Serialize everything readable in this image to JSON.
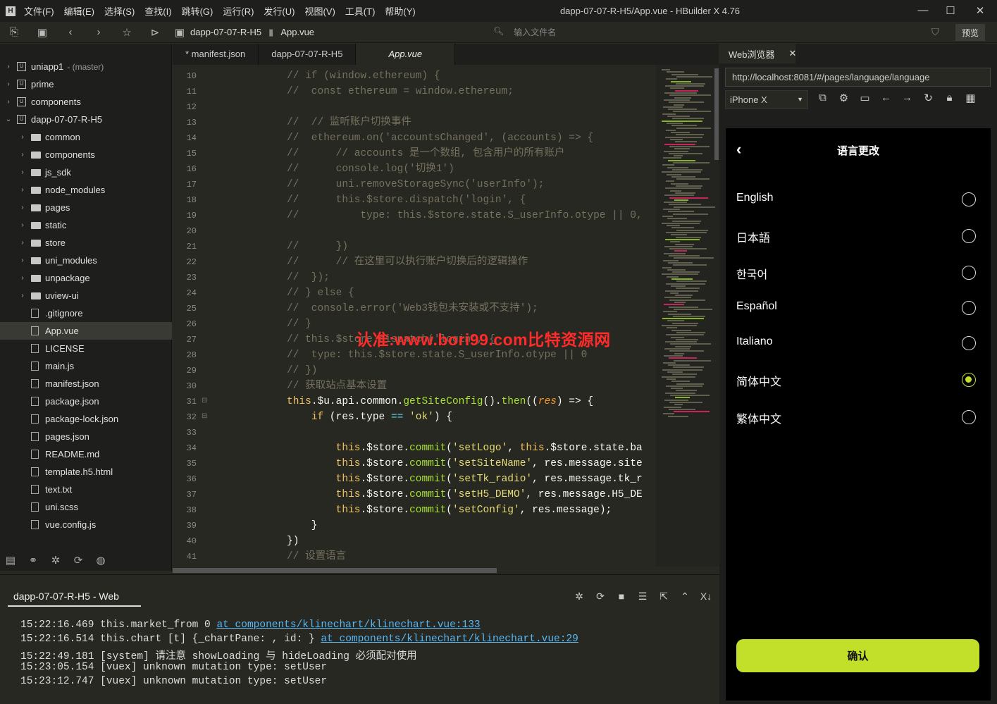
{
  "window": {
    "title": "dapp-07-07-R-H5/App.vue - HBuilder X 4.76",
    "minimize": "—",
    "maximize": "☐",
    "close": "✕"
  },
  "menu": [
    "文件(F)",
    "编辑(E)",
    "选择(S)",
    "查找(I)",
    "跳转(G)",
    "运行(R)",
    "发行(U)",
    "视图(V)",
    "工具(T)",
    "帮助(Y)"
  ],
  "toolbar": {
    "breadcrumb_project": "dapp-07-07-R-H5",
    "breadcrumb_file": "App.vue",
    "file_search_placeholder": "输入文件名",
    "preview_label": "预览"
  },
  "sidebar": {
    "rows": [
      {
        "label": "uniapp1",
        "branch": "- (master)",
        "kind": "project",
        "depth": 0,
        "chevron": "›"
      },
      {
        "label": "prime",
        "kind": "project",
        "depth": 0,
        "chevron": "›"
      },
      {
        "label": "components",
        "kind": "project",
        "depth": 0,
        "chevron": "›"
      },
      {
        "label": "dapp-07-07-R-H5",
        "kind": "project",
        "depth": 0,
        "chevron": "⌄"
      },
      {
        "label": "common",
        "kind": "folder",
        "depth": 1,
        "chevron": "›"
      },
      {
        "label": "components",
        "kind": "folder",
        "depth": 1,
        "chevron": "›"
      },
      {
        "label": "js_sdk",
        "kind": "folder",
        "depth": 1,
        "chevron": "›"
      },
      {
        "label": "node_modules",
        "kind": "folder",
        "depth": 1,
        "chevron": "›"
      },
      {
        "label": "pages",
        "kind": "folder",
        "depth": 1,
        "chevron": "›"
      },
      {
        "label": "static",
        "kind": "folder",
        "depth": 1,
        "chevron": "›"
      },
      {
        "label": "store",
        "kind": "folder",
        "depth": 1,
        "chevron": "›"
      },
      {
        "label": "uni_modules",
        "kind": "folder",
        "depth": 1,
        "chevron": "›"
      },
      {
        "label": "unpackage",
        "kind": "folder",
        "depth": 1,
        "chevron": "›"
      },
      {
        "label": "uview-ui",
        "kind": "folder",
        "depth": 1,
        "chevron": "›"
      },
      {
        "label": ".gitignore",
        "kind": "file",
        "depth": 1
      },
      {
        "label": "App.vue",
        "kind": "file",
        "depth": 1,
        "selected": true
      },
      {
        "label": "LICENSE",
        "kind": "file",
        "depth": 1
      },
      {
        "label": "main.js",
        "kind": "file",
        "depth": 1
      },
      {
        "label": "manifest.json",
        "kind": "file",
        "depth": 1
      },
      {
        "label": "package.json",
        "kind": "file",
        "depth": 1
      },
      {
        "label": "package-lock.json",
        "kind": "file",
        "depth": 1
      },
      {
        "label": "pages.json",
        "kind": "file",
        "depth": 1
      },
      {
        "label": "README.md",
        "kind": "file",
        "depth": 1
      },
      {
        "label": "template.h5.html",
        "kind": "file",
        "depth": 1
      },
      {
        "label": "text.txt",
        "kind": "file",
        "depth": 1
      },
      {
        "label": "uni.scss",
        "kind": "file",
        "depth": 1
      },
      {
        "label": "vue.config.js",
        "kind": "file",
        "depth": 1
      }
    ],
    "bottom_icons": [
      "files-icon",
      "binoculars-icon",
      "bug-icon",
      "git-icon",
      "globe-icon"
    ]
  },
  "tabs": [
    {
      "label": "* manifest.json"
    },
    {
      "label": "dapp-07-07-R-H5"
    },
    {
      "label": "App.vue",
      "active": true
    }
  ],
  "editor": {
    "lines": [
      {
        "n": "10",
        "t": "// if (window.ethereum) {"
      },
      {
        "n": "11",
        "t": "//  const ethereum = window.ethereum;"
      },
      {
        "n": "12",
        "t": ""
      },
      {
        "n": "13",
        "t": "//  // 监听账户切换事件"
      },
      {
        "n": "14",
        "t": "//  ethereum.on('accountsChanged', (accounts) => {"
      },
      {
        "n": "15",
        "t": "//      // accounts 是一个数组, 包含用户的所有账户"
      },
      {
        "n": "16",
        "t": "//      console.log('切换1')"
      },
      {
        "n": "17",
        "t": "//      uni.removeStorageSync('userInfo');"
      },
      {
        "n": "18",
        "t": "//      this.$store.dispatch('login', {"
      },
      {
        "n": "19",
        "t": "//          type: this.$store.state.S_userInfo.otype || 0,"
      },
      {
        "n": "20",
        "t": ""
      },
      {
        "n": "21",
        "t": "//      })"
      },
      {
        "n": "22",
        "t": "//      // 在这里可以执行账户切换后的逻辑操作"
      },
      {
        "n": "23",
        "t": "//  });"
      },
      {
        "n": "24",
        "t": "// } else {"
      },
      {
        "n": "25",
        "t": "//  console.error('Web3钱包未安装或不支持');"
      },
      {
        "n": "26",
        "t": "// }"
      },
      {
        "n": "27",
        "t": "// this.$store.dispatch('login', {"
      },
      {
        "n": "28",
        "t": "//  type: this.$store.state.S_userInfo.otype || 0"
      },
      {
        "n": "29",
        "t": "// })"
      },
      {
        "n": "30",
        "t": "// 获取站点基本设置"
      },
      {
        "n": "31",
        "t": "this.$u.api.common.getSiteConfig().then((res) => {",
        "live": true,
        "fold": "⊟"
      },
      {
        "n": "32",
        "t": "    if (res.type == 'ok') {",
        "live": true,
        "fold": "⊟"
      },
      {
        "n": "33",
        "t": ""
      },
      {
        "n": "34",
        "t": "        this.$store.commit('setLogo', this.$store.state.ba",
        "live": true
      },
      {
        "n": "35",
        "t": "        this.$store.commit('setSiteName', res.message.site",
        "live": true
      },
      {
        "n": "36",
        "t": "        this.$store.commit('setTk_radio', res.message.tk_r",
        "live": true
      },
      {
        "n": "37",
        "t": "        this.$store.commit('setH5_DEMO', res.message.H5_DE",
        "live": true
      },
      {
        "n": "38",
        "t": "        this.$store.commit('setConfig', res.message);",
        "live": true
      },
      {
        "n": "39",
        "t": "    }",
        "live": true
      },
      {
        "n": "40",
        "t": "})",
        "live": true
      },
      {
        "n": "41",
        "t": "// 设置语言"
      }
    ],
    "watermark": "认准:www.bori99.com比特资源网"
  },
  "browser": {
    "tab_label": "Web浏览器",
    "tab_close": "✕",
    "url": "http://localhost:8081/#/pages/language/language",
    "device": "iPhone X",
    "device_caret": "▼",
    "tools": [
      "open-external-icon",
      "gear-icon",
      "terminal-icon",
      "back-arrow-icon",
      "forward-arrow-icon",
      "refresh-icon",
      "lock-icon",
      "qrcode-icon"
    ]
  },
  "phone": {
    "back": "‹",
    "title": "语言更改",
    "languages": [
      {
        "label": "English",
        "selected": false
      },
      {
        "label": "日本語",
        "selected": false
      },
      {
        "label": "한국어",
        "selected": false
      },
      {
        "label": "Español",
        "selected": false
      },
      {
        "label": "Italiano",
        "selected": false
      },
      {
        "label": "简体中文",
        "selected": true
      },
      {
        "label": "繁体中文",
        "selected": false
      }
    ],
    "confirm": "确认",
    "accent": "#c2df2a"
  },
  "console": {
    "tab_label": "dapp-07-07-R-H5 - Web",
    "tools": [
      "bug-icon",
      "restart-icon",
      "stop-icon",
      "clear-filter-icon",
      "export-icon",
      "collapse-icon",
      "word-wrap-icon"
    ],
    "logs": [
      {
        "time": "15:22:16.469",
        "msg": "this.market_from 0 ",
        "link": "at components/klinechart/klinechart.vue:133"
      },
      {
        "time": "15:22:16.514",
        "msg": "this.chart [t] {_chartPane: , id: } ",
        "link": "at components/klinechart/klinechart.vue:29"
      },
      {
        "time": "15:22:49.181",
        "msg": "[system] 请注意 showLoading 与 hideLoading 必须配对使用",
        "link": ""
      },
      {
        "time": "15:23:05.154",
        "msg": "[vuex] unknown mutation type: setUser",
        "link": ""
      },
      {
        "time": "15:23:12.747",
        "msg": "[vuex] unknown mutation type: setUser",
        "link": ""
      }
    ]
  }
}
